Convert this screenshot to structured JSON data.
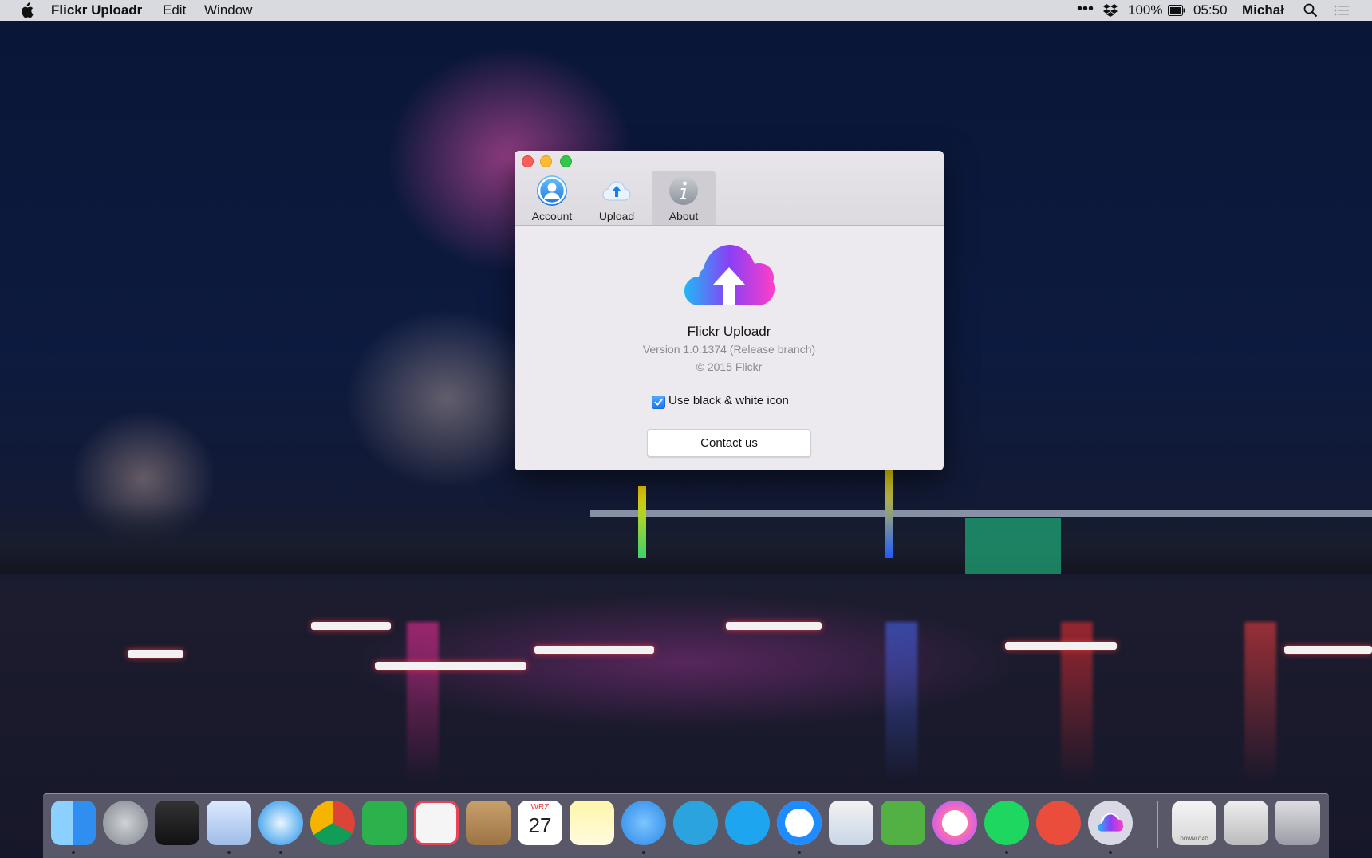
{
  "menubar": {
    "app_name": "Flickr Uploadr",
    "menus": [
      "Edit",
      "Window"
    ],
    "battery": "100%",
    "time": "05:50",
    "user": "Michał"
  },
  "window": {
    "tabs": [
      {
        "label": "Account",
        "icon": "account-icon"
      },
      {
        "label": "Upload",
        "icon": "upload-cloud-icon"
      },
      {
        "label": "About",
        "icon": "info-icon"
      }
    ],
    "active_tab": "About",
    "about": {
      "app_name": "Flickr Uploadr",
      "version": "Version 1.0.1374 (Release branch)",
      "copyright": "© 2015 Flickr",
      "checkbox_label": "Use black & white icon",
      "checkbox_checked": true,
      "contact_button": "Contact us"
    }
  },
  "dock": {
    "apps": [
      "finder-icon",
      "launchpad-icon",
      "photo-slideshow-icon",
      "mail-icon",
      "safari-icon",
      "chrome-icon",
      "feedly-icon",
      "pocket-icon",
      "contacts-icon",
      "calendar-icon",
      "notes-icon",
      "messages-icon",
      "telegram-icon",
      "skype-icon",
      "messenger-icon",
      "preview-icon",
      "evernote-icon",
      "itunes-icon",
      "spotify-icon",
      "downloader-icon",
      "flickr-uploadr-icon"
    ],
    "calendar_month": "WRZ",
    "calendar_day": "27",
    "download_label": "DOWNLOAD"
  },
  "colors": {
    "accent": "#1e78f0",
    "cloud_gradient": [
      "#20b8f5",
      "#8a3ff5",
      "#ff3ec8"
    ]
  }
}
